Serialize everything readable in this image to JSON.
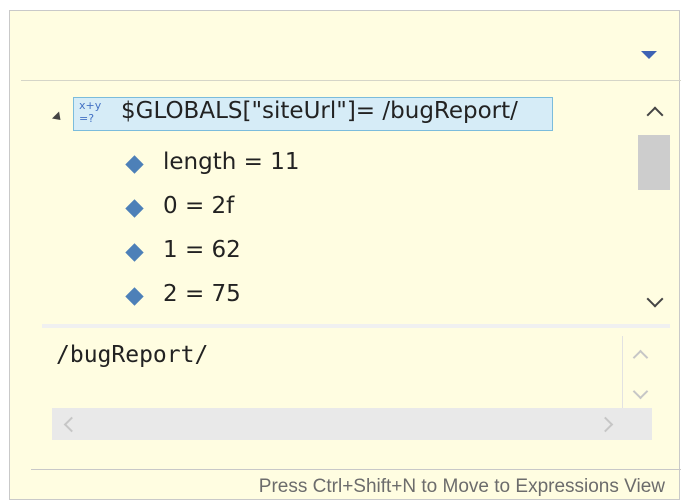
{
  "expression": {
    "icon": "watch-expression-icon",
    "label": "$GLOBALS[\"siteUrl\"]= /bugReport/",
    "children": [
      {
        "icon": "field-diamond-icon",
        "label": "length = 11"
      },
      {
        "icon": "field-diamond-icon",
        "label": "0 = 2f"
      },
      {
        "icon": "field-diamond-icon",
        "label": "1 = 62"
      },
      {
        "icon": "field-diamond-icon",
        "label": "2 = 75"
      }
    ]
  },
  "detail": {
    "value": "/bugReport/"
  },
  "status": {
    "hint": "Press Ctrl+Shift+N to Move to Expressions View"
  },
  "colors": {
    "background": "#fffde1",
    "selection": "#d6ecf7",
    "selection_border": "#7bbcdc",
    "accent": "#3e63b4"
  }
}
